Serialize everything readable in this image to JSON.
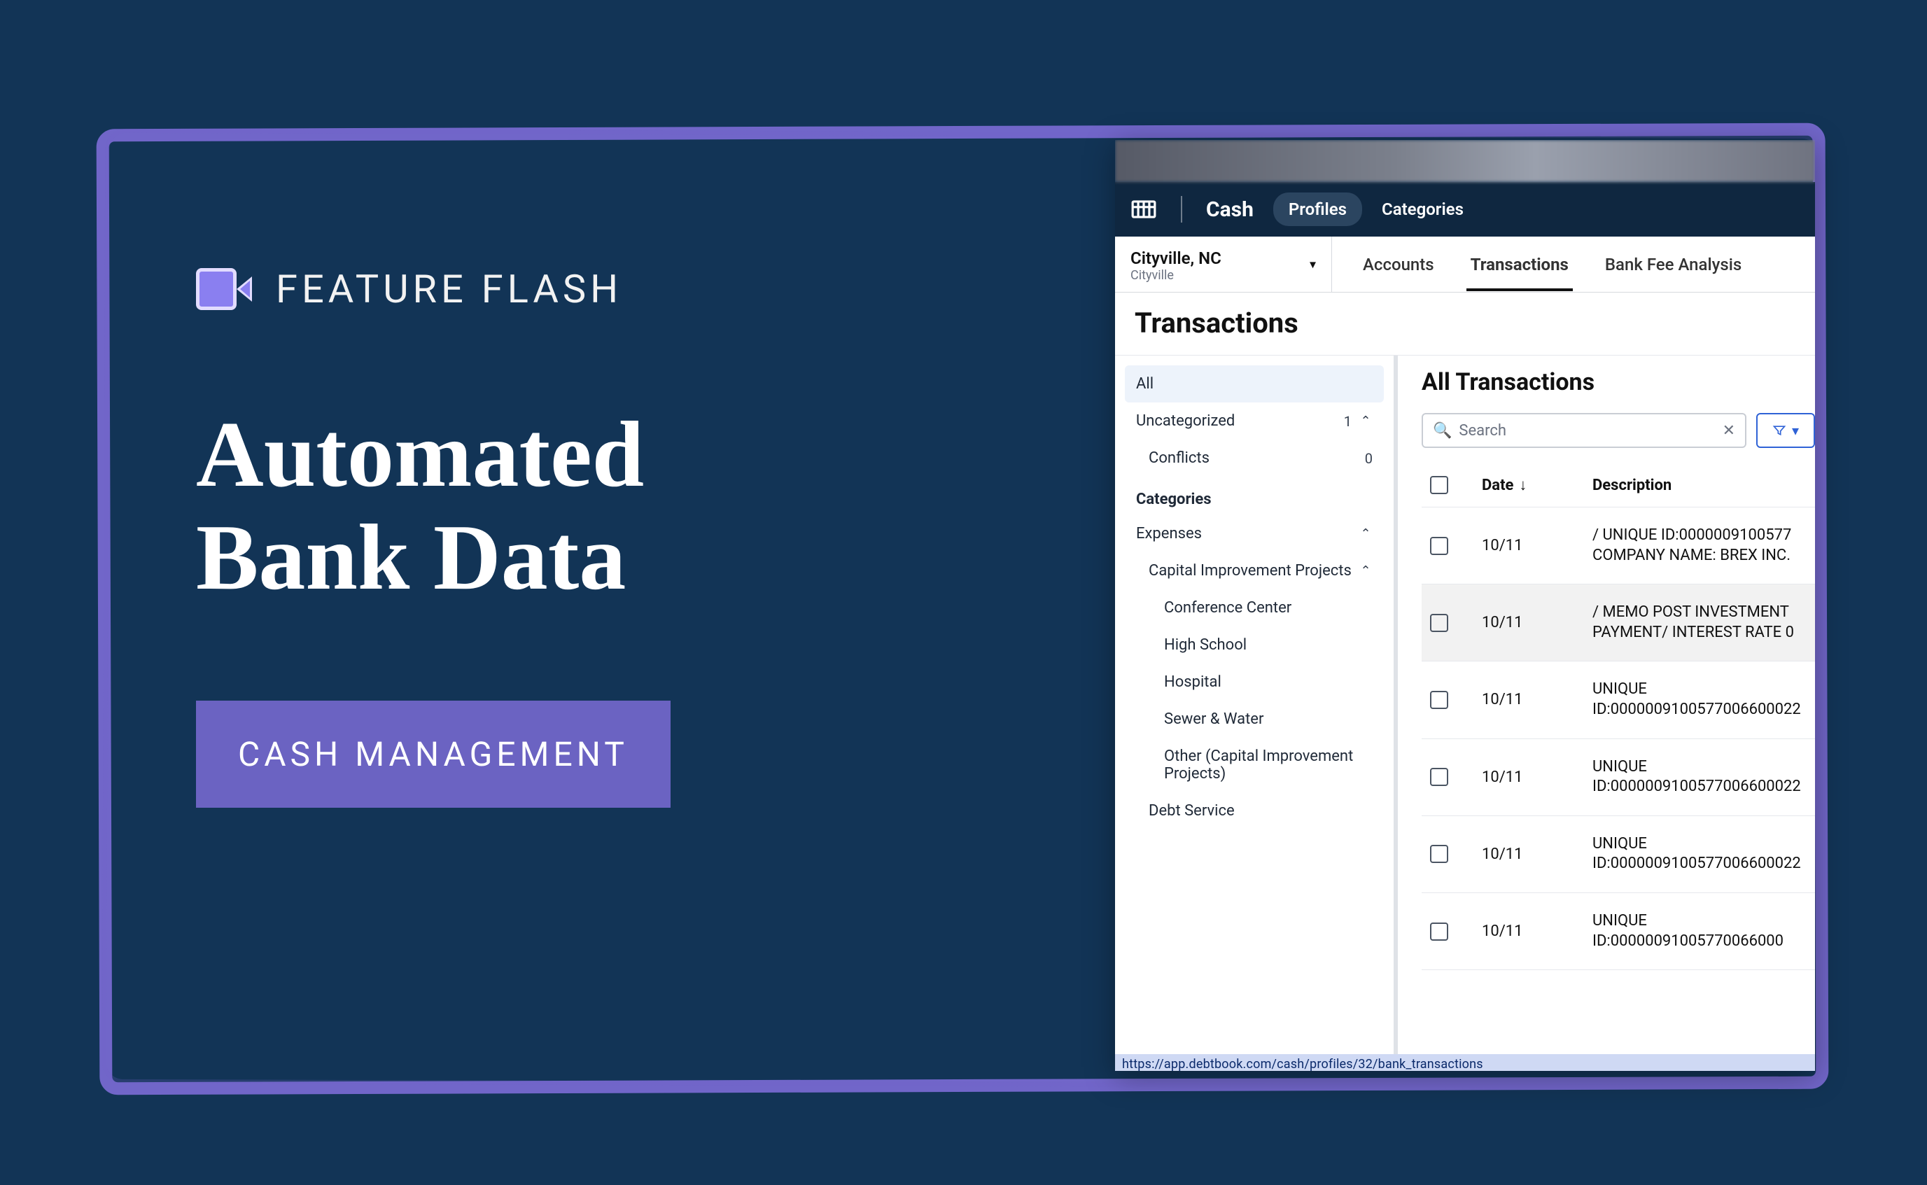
{
  "promo": {
    "eyebrow": "FEATURE FLASH",
    "headline_line1": "Automated",
    "headline_line2": "Bank Data",
    "pill": "CASH MANAGEMENT"
  },
  "app": {
    "name": "Cash",
    "topnav": {
      "profiles": "Profiles",
      "categories": "Categories"
    },
    "org": {
      "name": "Cityville, NC",
      "sub": "Cityville"
    },
    "subtabs": {
      "accounts": "Accounts",
      "transactions": "Transactions",
      "bank_fee": "Bank Fee Analysis"
    },
    "page_title": "Transactions",
    "sidebar": {
      "all": "All",
      "uncategorized": {
        "label": "Uncategorized",
        "count": "1"
      },
      "conflicts": {
        "label": "Conflicts",
        "count": "0"
      },
      "categories_header": "Categories",
      "expenses": "Expenses",
      "cip": "Capital Improvement Projects",
      "cip_children": {
        "conference": "Conference Center",
        "highschool": "High School",
        "hospital": "Hospital",
        "sewer": "Sewer & Water",
        "other": "Other (Capital Improvement Projects)"
      },
      "debt_service": "Debt Service"
    },
    "main": {
      "title": "All Transactions",
      "search_placeholder": "Search",
      "columns": {
        "date": "Date",
        "desc": "Description"
      },
      "rows": [
        {
          "date": "10/11",
          "desc": "/ UNIQUE ID:0000009100577 COMPANY NAME: BREX INC."
        },
        {
          "date": "10/11",
          "desc": "/ MEMO POST INVESTMENT PAYMENT/ INTEREST RATE 0"
        },
        {
          "date": "10/11",
          "desc": "UNIQUE ID:0000009100577006600022"
        },
        {
          "date": "10/11",
          "desc": "UNIQUE ID:0000009100577006600022"
        },
        {
          "date": "10/11",
          "desc": "UNIQUE ID:0000009100577006600022"
        },
        {
          "date": "10/11",
          "desc": "UNIQUE ID:00000091005770066000"
        }
      ]
    },
    "status_url": "https://app.debtbook.com/cash/profiles/32/bank_transactions"
  }
}
